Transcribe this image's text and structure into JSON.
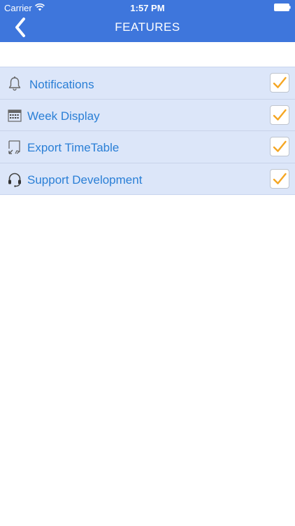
{
  "status_bar": {
    "carrier": "Carrier",
    "time": "1:57 PM"
  },
  "nav": {
    "title": "FEATURES"
  },
  "features": [
    {
      "label": "Notifications",
      "icon": "bell-icon",
      "checked": true
    },
    {
      "label": "Week Display",
      "icon": "calendar-icon",
      "checked": true
    },
    {
      "label": "Export TimeTable",
      "icon": "export-icon",
      "checked": true
    },
    {
      "label": "Support Development",
      "icon": "headset-icon",
      "checked": true
    }
  ],
  "colors": {
    "header": "#3e76dc",
    "list_background": "#dce6f9",
    "label": "#2a7fd6",
    "checkmark": "#f5a623"
  }
}
